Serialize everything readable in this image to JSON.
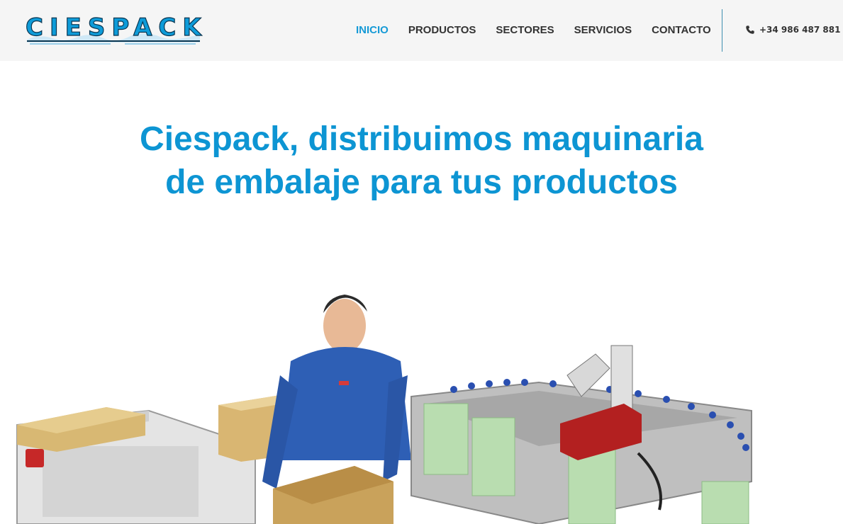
{
  "header": {
    "logo_text": "CIESPACK",
    "nav": [
      {
        "label": "INICIO",
        "active": true
      },
      {
        "label": "PRODUCTOS",
        "active": false
      },
      {
        "label": "SECTORES",
        "active": false
      },
      {
        "label": "SERVICIOS",
        "active": false
      },
      {
        "label": "CONTACTO",
        "active": false
      }
    ],
    "phone": "+34 986 487 881",
    "phone_icon": "phone-icon"
  },
  "hero": {
    "title_line1": "Ciespack, distribuimos maquinaria",
    "title_line2": "de embalaje para tus productos"
  },
  "colors": {
    "accent": "#169ad6",
    "title": "#0d95d3",
    "header_bg": "#f5f5f5",
    "nav_text": "#333333"
  }
}
